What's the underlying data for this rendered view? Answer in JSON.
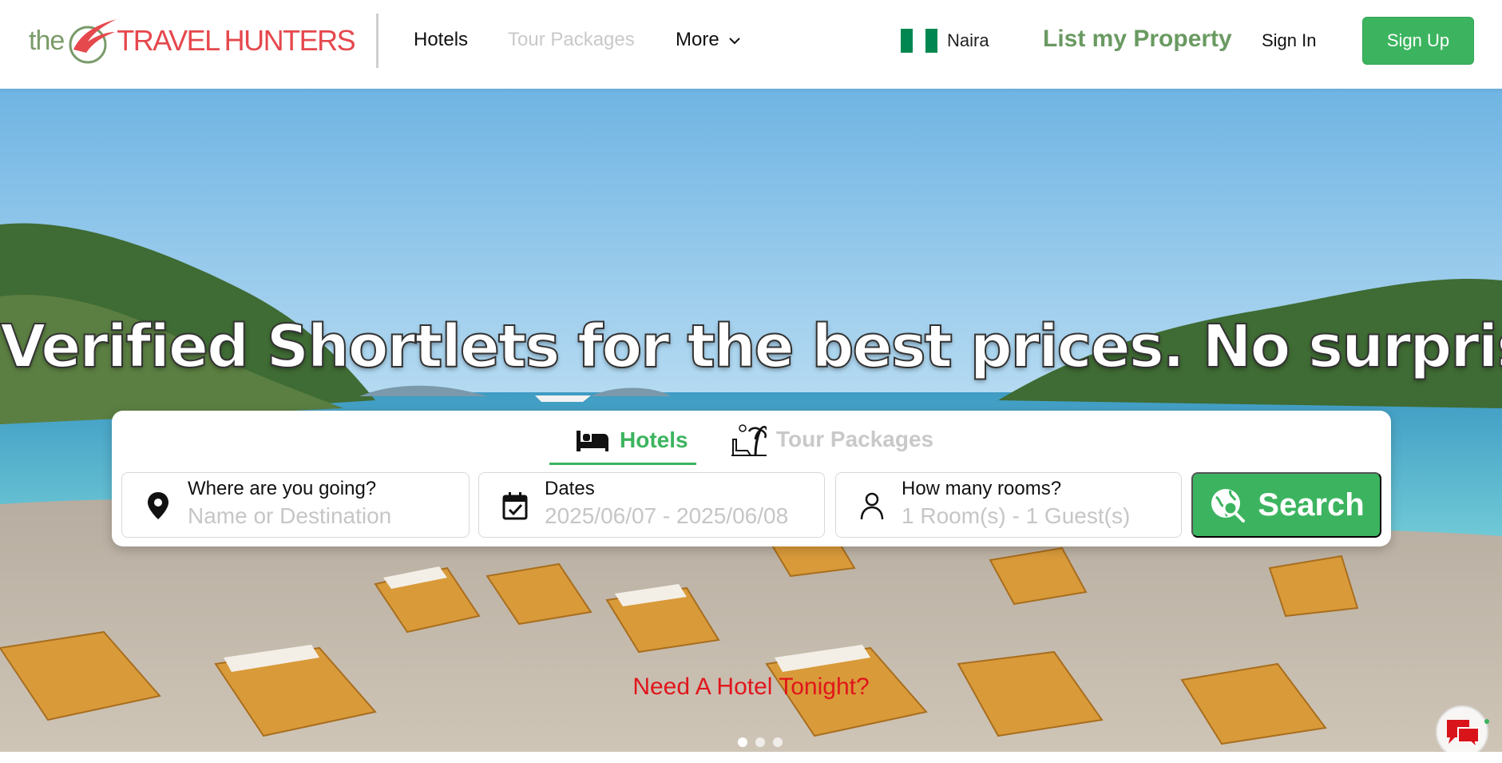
{
  "brand": {
    "logo_prefix": "the",
    "logo_travel": "TRAVEL",
    "logo_hunters": "HUNTERS",
    "colors": {
      "green": "#3cb45f",
      "red": "#e5484d",
      "olive": "#6a9a62"
    }
  },
  "header": {
    "nav": {
      "hotels": "Hotels",
      "tour_packages": "Tour Packages",
      "more": "More"
    },
    "currency": {
      "label": "Naira",
      "flag_icon": "nigeria-flag-icon"
    },
    "list_property": "List my Property",
    "sign_in": "Sign In",
    "sign_up": "Sign Up"
  },
  "hero": {
    "headline": "Verified Shortlets for the best prices. No surprises!",
    "search": {
      "tabs": [
        {
          "label": "Hotels",
          "icon": "bed-icon",
          "active": true
        },
        {
          "label": "Tour Packages",
          "icon": "beach-palm-icon",
          "active": false
        }
      ],
      "destination": {
        "label": "Where are you going?",
        "placeholder": "Name or Destination",
        "icon": "map-pin-icon"
      },
      "dates": {
        "label": "Dates",
        "value": "2025/06/07 - 2025/06/08",
        "icon": "calendar-check-icon"
      },
      "rooms": {
        "label": "How many rooms?",
        "value": "1 Room(s) - 1 Guest(s)",
        "icon": "person-icon"
      },
      "button_label": "Search",
      "button_icon": "globe-search-icon"
    },
    "promo": "Need A Hotel Tonight?",
    "carousel": {
      "slides": 3,
      "active_index": 0
    }
  },
  "chat": {
    "icon": "chat-bubbles-icon"
  }
}
